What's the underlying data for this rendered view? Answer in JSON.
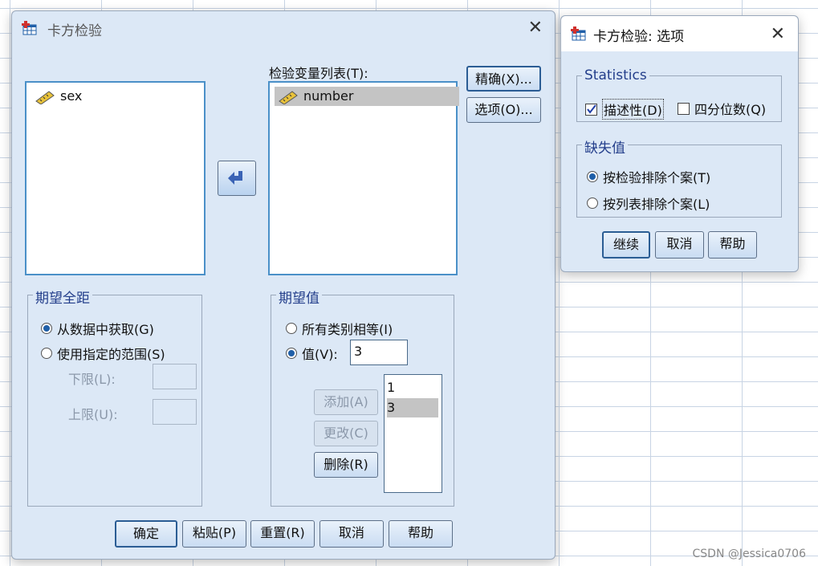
{
  "main_dialog": {
    "title": "卡方检验",
    "source_vars": [
      "sex"
    ],
    "test_list_label": "检验变量列表(T):",
    "test_vars": [
      "number"
    ],
    "buttons_right": {
      "exact": "精确(X)...",
      "options": "选项(O)..."
    },
    "expected_range": {
      "legend": "期望全距",
      "from_data": "从数据中获取(G)",
      "from_data_selected": true,
      "use_range": "使用指定的范围(S)",
      "lower_label": "下限(L):",
      "lower_value": "",
      "upper_label": "上限(U):",
      "upper_value": ""
    },
    "expected_values": {
      "legend": "期望值",
      "all_equal": "所有类别相等(I)",
      "values_opt": "值(V):",
      "values_selected": true,
      "value_input": "3",
      "add": "添加(A)",
      "change": "更改(C)",
      "remove": "删除(R)",
      "list": [
        "1",
        "3"
      ],
      "selected_index": 1
    },
    "bottom_buttons": {
      "ok": "确定",
      "paste": "粘贴(P)",
      "reset": "重置(R)",
      "cancel": "取消",
      "help": "帮助"
    }
  },
  "options_dialog": {
    "title": "卡方检验: 选项",
    "statistics": {
      "legend": "Statistics",
      "descriptive": "描述性(D)",
      "descriptive_checked": true,
      "quartiles": "四分位数(Q)",
      "quartiles_checked": false
    },
    "missing": {
      "legend": "缺失值",
      "by_test": "按检验排除个案(T)",
      "by_test_selected": true,
      "listwise": "按列表排除个案(L)",
      "listwise_selected": false
    },
    "buttons": {
      "continue": "继续",
      "cancel": "取消",
      "help": "帮助"
    }
  },
  "watermark": "CSDN @Jessica0706"
}
